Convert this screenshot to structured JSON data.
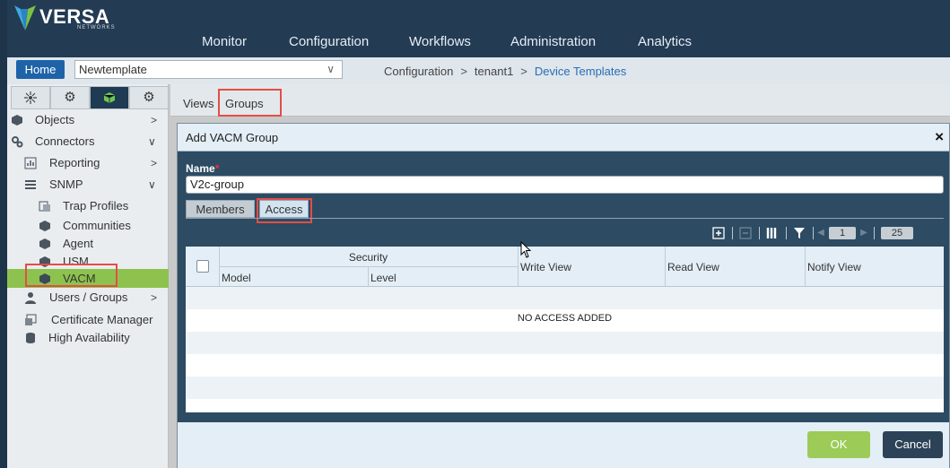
{
  "brand": {
    "name": "VERSA",
    "sub": "NETWORKS"
  },
  "nav": [
    "Monitor",
    "Configuration",
    "Workflows",
    "Administration",
    "Analytics"
  ],
  "subbar": {
    "home_label": "Home",
    "template_value": "Newtemplate",
    "breadcrumb": [
      "Configuration",
      "tenant1",
      "Device Templates"
    ],
    "breadcrumb_sep": ">"
  },
  "sidebar": {
    "tabs": [
      "network-icon",
      "gear-icon",
      "cube-icon",
      "settings-cog-icon"
    ],
    "items": [
      {
        "label": "Objects",
        "icon": "cube-icon",
        "arrow": "right"
      },
      {
        "label": "Connectors",
        "icon": "cogs-icon",
        "arrow": "down"
      },
      {
        "label": "Reporting",
        "icon": "report-icon",
        "arrow": "right"
      },
      {
        "label": "SNMP",
        "icon": "server-icon",
        "arrow": "down"
      },
      {
        "label": "Trap Profiles",
        "icon": "trap-icon"
      },
      {
        "label": "Communities",
        "icon": "cube-icon"
      },
      {
        "label": "Agent",
        "icon": "cube-icon"
      },
      {
        "label": "USM",
        "icon": "cube-icon"
      },
      {
        "label": "VACM",
        "icon": "cube-icon",
        "selected": true
      },
      {
        "label": "Users / Groups",
        "icon": "user-icon",
        "arrow": "right"
      },
      {
        "label": "Certificate Manager",
        "icon": "certificate-icon"
      },
      {
        "label": "High Availability",
        "icon": "database-icon"
      }
    ]
  },
  "views_tabs": {
    "views": "Views",
    "groups": "Groups"
  },
  "modal": {
    "title": "Add VACM Group",
    "close": "×",
    "name_label": "Name",
    "required_mark": "*",
    "name_value": "V2c-group",
    "tabs": {
      "members": "Members",
      "access": "Access"
    },
    "toolbar": {
      "page": "1",
      "page_size": "25"
    },
    "table": {
      "security_header": "Security",
      "columns": [
        "Model",
        "Level",
        "Write View",
        "Read View",
        "Notify View"
      ],
      "empty_message": "NO ACCESS ADDED"
    },
    "ok_label": "OK",
    "cancel_label": "Cancel"
  },
  "colors": {
    "header": "#233b53",
    "accent_green": "#8ec24e",
    "home_blue": "#1e63a8",
    "highlight_red": "#e24e45"
  }
}
